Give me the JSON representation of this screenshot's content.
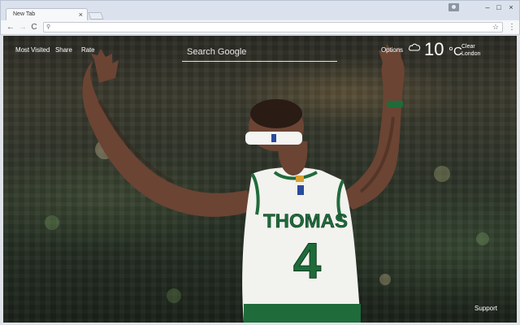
{
  "browser": {
    "tab_title": "New Tab",
    "tab_close": "×",
    "window_minimize": "–",
    "window_maximize": "□",
    "window_close": "×",
    "back": "←",
    "forward": "→",
    "reload": "C",
    "omnibox_value": "",
    "star": "☆",
    "menu": "⋮",
    "search_glyph": "⚲"
  },
  "page": {
    "links": {
      "most_visited": "Most Visited",
      "share": "Share",
      "rate": "Rate",
      "options": "Options",
      "support": "Support"
    },
    "search": {
      "placeholder": "Search Google"
    },
    "weather": {
      "temperature": "10",
      "unit": "°C",
      "condition": "Clear",
      "city": "London",
      "icon": "cloud-icon"
    },
    "wallpaper": {
      "jersey_name": "THOMAS",
      "jersey_number": "4",
      "colors": {
        "jersey": "#f2f2ee",
        "trim": "#1f6b3a",
        "skin": "#6b4433"
      }
    }
  }
}
